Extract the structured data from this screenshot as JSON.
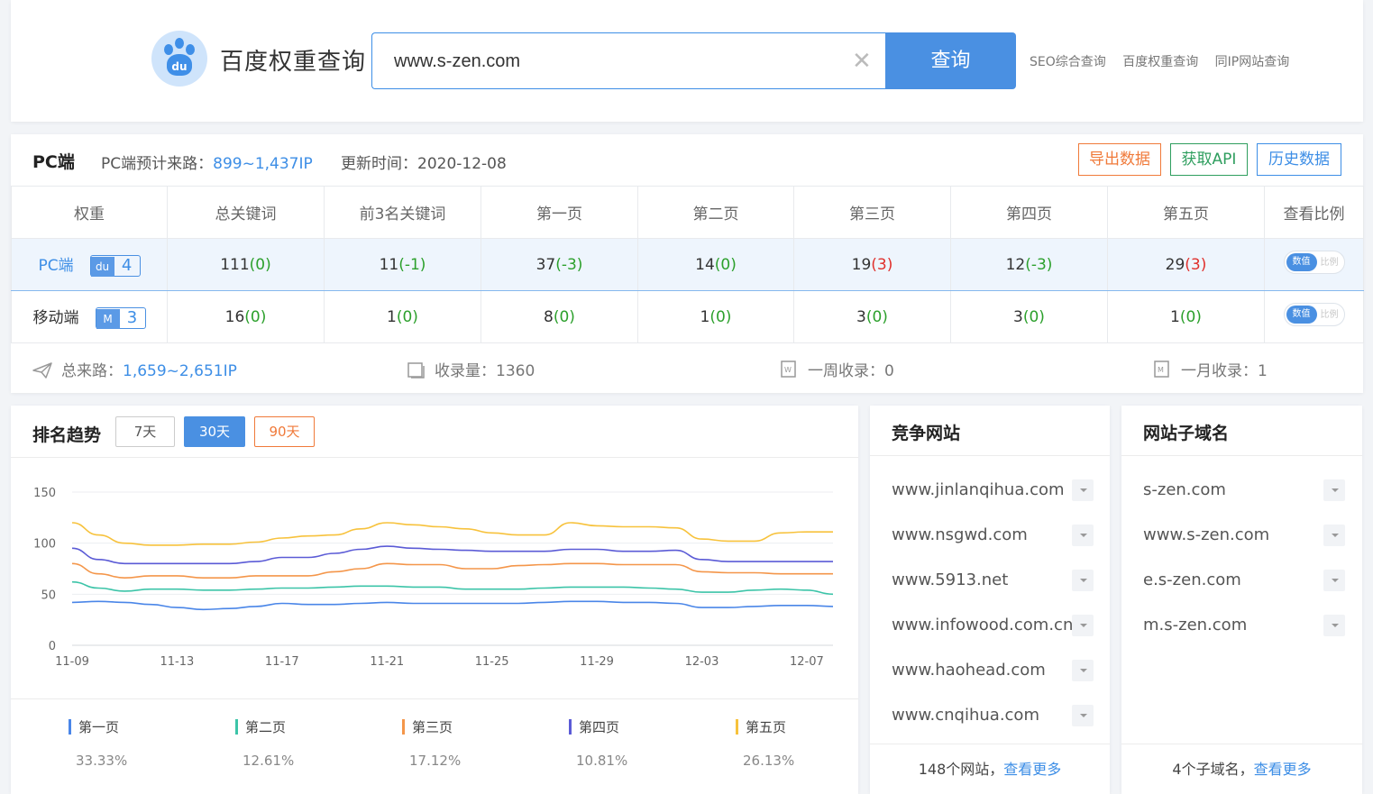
{
  "header": {
    "brand": "百度权重查询",
    "search_value": "www.s-zen.com",
    "search_button": "查询",
    "links": [
      "SEO综合查询",
      "百度权重查询",
      "同IP网站查询"
    ]
  },
  "overview": {
    "title": "PC端",
    "traffic_label": "PC端预计来路：",
    "traffic_value": "899~1,437IP",
    "update_label": "更新时间：",
    "update_value": "2020-12-08",
    "buttons": {
      "export": "导出数据",
      "api": "获取API",
      "history": "历史数据"
    },
    "columns": [
      "权重",
      "总关键词",
      "前3名关键词",
      "第一页",
      "第二页",
      "第三页",
      "第四页",
      "第五页",
      "查看比例"
    ],
    "rows": [
      {
        "label": "PC端",
        "badge_icon": "du",
        "weight": "4",
        "cells": [
          {
            "v": "111",
            "d": "(0)",
            "c": "green"
          },
          {
            "v": "11",
            "d": "(-1)",
            "c": "green"
          },
          {
            "v": "37",
            "d": "(-3)",
            "c": "green"
          },
          {
            "v": "14",
            "d": "(0)",
            "c": "green"
          },
          {
            "v": "19",
            "d": "(3)",
            "c": "red"
          },
          {
            "v": "12",
            "d": "(-3)",
            "c": "green"
          },
          {
            "v": "29",
            "d": "(3)",
            "c": "red"
          }
        ]
      },
      {
        "label": "移动端",
        "badge_icon": "M",
        "weight": "3",
        "cells": [
          {
            "v": "16",
            "d": "(0)",
            "c": "green"
          },
          {
            "v": "1",
            "d": "(0)",
            "c": "green"
          },
          {
            "v": "8",
            "d": "(0)",
            "c": "green"
          },
          {
            "v": "1",
            "d": "(0)",
            "c": "green"
          },
          {
            "v": "3",
            "d": "(0)",
            "c": "green"
          },
          {
            "v": "3",
            "d": "(0)",
            "c": "green"
          },
          {
            "v": "1",
            "d": "(0)",
            "c": "green"
          }
        ]
      }
    ],
    "toggle": {
      "on": "数值",
      "off": "比例"
    },
    "total_traffic_label": "总来路：",
    "total_traffic_value": "1,659~2,651IP",
    "indexed_label": "收录量：",
    "indexed_value": "1360",
    "week_label": "一周收录：",
    "week_value": "0",
    "month_label": "一月收录：",
    "month_value": "1"
  },
  "trend": {
    "title": "排名趋势",
    "ranges": [
      "7天",
      "30天",
      "90天"
    ],
    "active_range": "30天",
    "legend": [
      {
        "name": "第一页",
        "pct": "33.33%",
        "color": "#4a86e8"
      },
      {
        "name": "第二页",
        "pct": "12.61%",
        "color": "#3cc4a8"
      },
      {
        "name": "第三页",
        "pct": "17.12%",
        "color": "#f4964a"
      },
      {
        "name": "第四页",
        "pct": "10.81%",
        "color": "#5b5bd6"
      },
      {
        "name": "第五页",
        "pct": "26.13%",
        "color": "#f7c23c"
      }
    ]
  },
  "chart_data": {
    "type": "line",
    "ylim": [
      0,
      150
    ],
    "yticks": [
      0,
      50,
      100,
      150
    ],
    "xticks": [
      "11-09",
      "11-13",
      "11-17",
      "11-21",
      "11-25",
      "11-29",
      "12-03",
      "12-07"
    ],
    "x": [
      "11-09",
      "11-10",
      "11-11",
      "11-12",
      "11-13",
      "11-14",
      "11-15",
      "11-16",
      "11-17",
      "11-18",
      "11-19",
      "11-20",
      "11-21",
      "11-22",
      "11-23",
      "11-24",
      "11-25",
      "11-26",
      "11-27",
      "11-28",
      "11-29",
      "11-30",
      "12-01",
      "12-02",
      "12-03",
      "12-04",
      "12-05",
      "12-06",
      "12-07",
      "12-08"
    ],
    "series": [
      {
        "name": "第一页",
        "color": "#4a86e8",
        "values": [
          42,
          43,
          42,
          40,
          37,
          35,
          36,
          38,
          41,
          40,
          40,
          41,
          42,
          41,
          41,
          41,
          41,
          41,
          42,
          43,
          43,
          42,
          42,
          41,
          37,
          37,
          38,
          39,
          39,
          38
        ]
      },
      {
        "name": "第二页",
        "color": "#3cc4a8",
        "values": [
          62,
          56,
          53,
          55,
          55,
          54,
          54,
          55,
          56,
          56,
          57,
          58,
          58,
          57,
          57,
          55,
          55,
          55,
          56,
          57,
          57,
          57,
          56,
          55,
          52,
          52,
          54,
          55,
          54,
          50
        ]
      },
      {
        "name": "第三页",
        "color": "#f4964a",
        "values": [
          80,
          70,
          66,
          68,
          68,
          66,
          66,
          68,
          68,
          68,
          72,
          75,
          80,
          79,
          79,
          75,
          75,
          78,
          79,
          80,
          80,
          79,
          79,
          79,
          72,
          71,
          71,
          70,
          70,
          70
        ]
      },
      {
        "name": "第四页",
        "color": "#5b5bd6",
        "values": [
          95,
          84,
          80,
          80,
          80,
          80,
          80,
          82,
          86,
          86,
          90,
          94,
          97,
          95,
          94,
          93,
          92,
          92,
          92,
          94,
          94,
          92,
          92,
          93,
          84,
          82,
          82,
          82,
          82,
          82
        ]
      },
      {
        "name": "第五页",
        "color": "#f7c23c",
        "values": [
          120,
          108,
          100,
          98,
          98,
          99,
          99,
          101,
          105,
          107,
          108,
          114,
          120,
          118,
          116,
          114,
          110,
          108,
          108,
          120,
          117,
          116,
          116,
          115,
          104,
          102,
          102,
          110,
          111,
          111
        ]
      }
    ]
  },
  "competitors": {
    "title": "竞争网站",
    "items": [
      "www.jinlanqihua.com",
      "www.nsgwd.com",
      "www.5913.net",
      "www.infowood.com.cn",
      "www.haohead.com",
      "www.cnqihua.com"
    ],
    "count_text": "148个网站，",
    "more": "查看更多"
  },
  "subdomains": {
    "title": "网站子域名",
    "items": [
      "s-zen.com",
      "www.s-zen.com",
      "e.s-zen.com",
      "m.s-zen.com"
    ],
    "count_text": "4个子域名，",
    "more": "查看更多"
  }
}
